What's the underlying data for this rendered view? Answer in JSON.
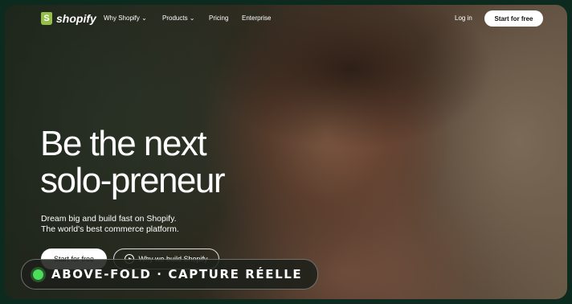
{
  "nav": {
    "logo_glyph": "S",
    "logo_text": "shopify",
    "links": [
      "Why Shopify ⌄",
      "Products ⌄",
      "Pricing",
      "Enterprise"
    ],
    "login": "Log in",
    "start": "Start for free"
  },
  "hero": {
    "title_line1": "Be the next",
    "title_line2": "solo-preneur",
    "sub_line1": "Dream big and build fast on Shopify.",
    "sub_line2": "The world's best commerce platform.",
    "cta_primary": "Start for free",
    "cta_secondary": "Why we build Shopify"
  },
  "badge": {
    "text": "ABOVE-FOLD · CAPTURE RÉELLE",
    "dot_color": "#4ade5a"
  },
  "colors": {
    "brand_green": "#95bf47"
  }
}
